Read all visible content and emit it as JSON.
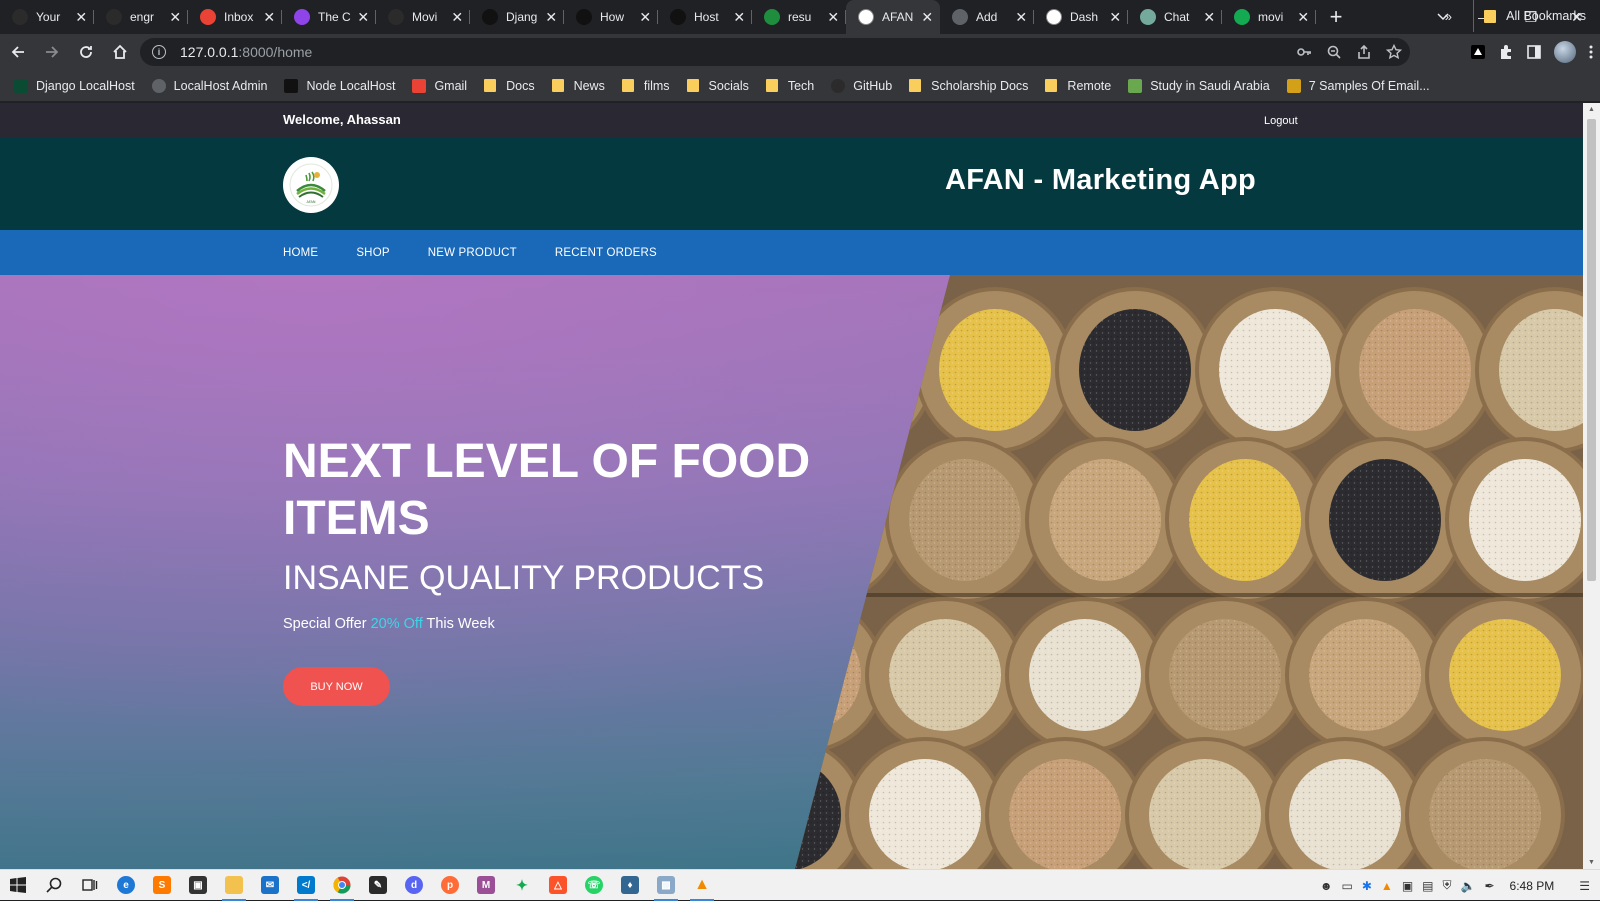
{
  "browser": {
    "tabs": [
      {
        "title": "Your",
        "icon": "github-icon",
        "color": "#2b2b2b"
      },
      {
        "title": "engr",
        "icon": "github-icon",
        "color": "#2b2b2b"
      },
      {
        "title": "Inbox",
        "icon": "gmail-icon",
        "color": "#ea4335"
      },
      {
        "title": "The C",
        "icon": "u-badge-icon",
        "color": "#8e44e8"
      },
      {
        "title": "Movi",
        "icon": "github-icon",
        "color": "#2b2b2b"
      },
      {
        "title": "Djang",
        "icon": "medium-icon",
        "color": "#111111"
      },
      {
        "title": "How",
        "icon": "dev-icon",
        "color": "#111111"
      },
      {
        "title": "Host",
        "icon": "dev-icon",
        "color": "#111111"
      },
      {
        "title": "resu",
        "icon": "chart-icon",
        "color": "#1e8e3e"
      },
      {
        "title": "AFAN",
        "icon": "afan-icon",
        "color": "#ffffff",
        "active": true
      },
      {
        "title": "Add",
        "icon": "globe-icon",
        "color": "#5f6368"
      },
      {
        "title": "Dash",
        "icon": "triangle-icon",
        "color": "#ffffff"
      },
      {
        "title": "Chat",
        "icon": "chatgpt-icon",
        "color": "#74aa9c"
      },
      {
        "title": "movi",
        "icon": "n-icon",
        "color": "#13aa52"
      }
    ],
    "url_host": "127.0.0.1",
    "url_path": ":8000/home",
    "bookmarks": [
      {
        "label": "Django LocalHost",
        "icon": "django-icon"
      },
      {
        "label": "LocalHost Admin",
        "icon": "globe-icon"
      },
      {
        "label": "Node LocalHost",
        "icon": "node-icon"
      },
      {
        "label": "Gmail",
        "icon": "gmail-icon"
      },
      {
        "label": "Docs",
        "icon": "folder-icon"
      },
      {
        "label": "News",
        "icon": "folder-icon"
      },
      {
        "label": "films",
        "icon": "folder-icon"
      },
      {
        "label": "Socials",
        "icon": "folder-icon"
      },
      {
        "label": "Tech",
        "icon": "folder-icon"
      },
      {
        "label": "GitHub",
        "icon": "github-icon"
      },
      {
        "label": "Scholarship Docs",
        "icon": "folder-icon"
      },
      {
        "label": "Remote",
        "icon": "folder-icon"
      },
      {
        "label": "Study in Saudi Arabia",
        "icon": "web-icon"
      },
      {
        "label": "7 Samples Of Email...",
        "icon": "bookmark-icon"
      }
    ],
    "bookmarks_more": "»",
    "all_bookmarks": "All Bookmarks"
  },
  "site": {
    "welcome": "Welcome, Ahassan",
    "logout": "Logout",
    "app_title": "AFAN - Marketing App",
    "nav": [
      "HOME",
      "SHOP",
      "NEW PRODUCT",
      "RECENT ORDERS"
    ],
    "hero": {
      "heading": "NEXT LEVEL OF FOOD ITEMS",
      "subheading": "INSANE QUALITY PRODUCTS",
      "offer_prefix": "Special Offer",
      "offer_highlight": "20% Off",
      "offer_suffix": "This Week",
      "button": "BUY NOW"
    },
    "colors": {
      "topbar": "#2a2832",
      "header": "#04393f",
      "nav": "#1a68b8",
      "button": "#f0524f",
      "accent": "#3cd5e8"
    }
  },
  "taskbar": {
    "time": "6:48 PM"
  }
}
